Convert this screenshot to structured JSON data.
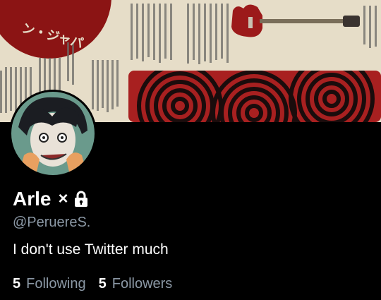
{
  "banner": {
    "text": "ン・ジャパ"
  },
  "profile": {
    "display_name": "Arle",
    "name_symbol": "×",
    "lock_icon": "lock-icon",
    "handle": "@PeruereS.",
    "bio": "I don't use Twitter much"
  },
  "stats": {
    "following_count": "5",
    "following_label": "Following",
    "followers_count": "5",
    "followers_label": "Followers"
  }
}
